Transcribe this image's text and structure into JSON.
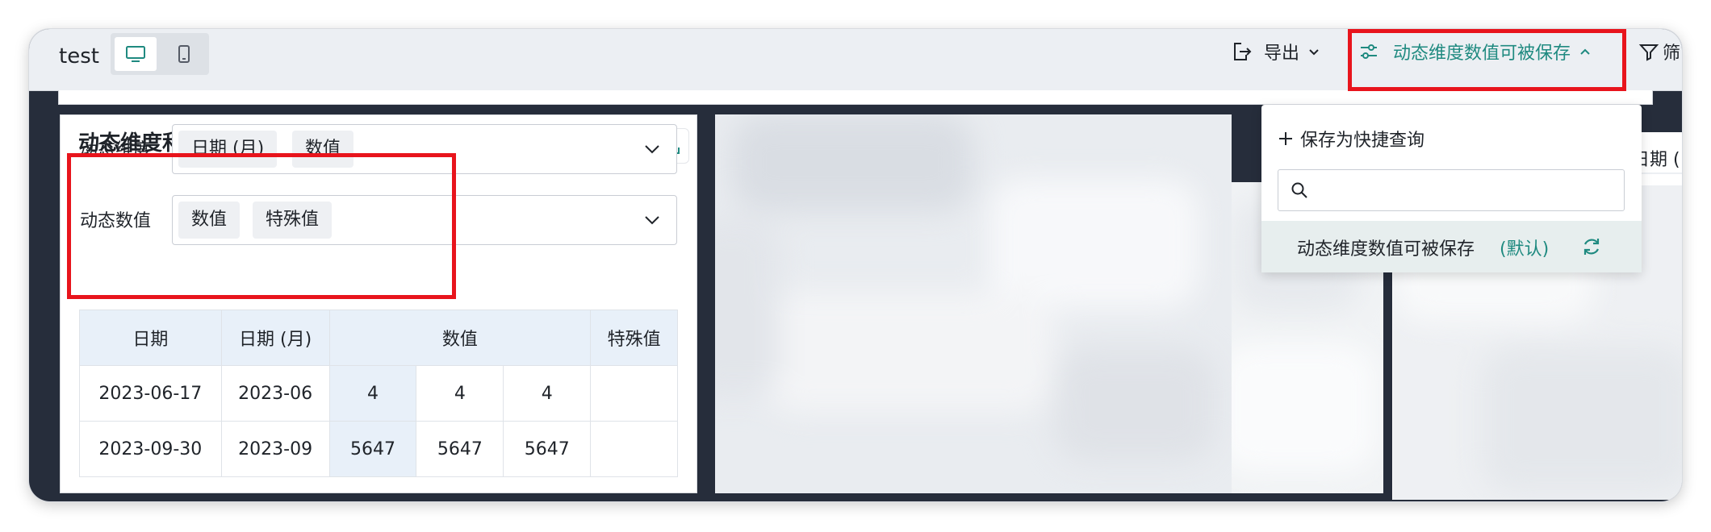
{
  "header": {
    "title": "test",
    "export_label": "导出",
    "query_label": "动态维度数值可被保存",
    "filter_label_partial": "筛"
  },
  "widget": {
    "title": "动态维度和数值",
    "dimension_label": "动态维度",
    "dimension_chips": [
      "日期 (月)",
      "数值"
    ],
    "value_label": "动态数值",
    "value_chips": [
      "数值",
      "特殊值"
    ]
  },
  "table": {
    "headers": [
      "日期",
      "日期 (月)",
      "数值",
      "特殊值"
    ],
    "rows": [
      [
        "2023-06-17",
        "2023-06",
        "4",
        "4",
        "4",
        ""
      ],
      [
        "2023-09-30",
        "2023-09",
        "5647",
        "5647",
        "5647",
        ""
      ]
    ]
  },
  "dropdown": {
    "save_as_label": "保存为快捷查询",
    "search_placeholder": "",
    "item_label": "动态维度数值可被保存",
    "item_default": "(默认)"
  },
  "right_panel": {
    "column_header_partial": "日期 ("
  },
  "colors": {
    "accent": "#1f8a80",
    "highlight_red": "#e8141c",
    "header_fill": "#e8f0f9",
    "dark_background": "#262d3b"
  },
  "icons": [
    "monitor-icon",
    "mobile-icon",
    "export-icon",
    "chevron-down-icon",
    "sliders-icon",
    "chevron-up-icon",
    "filter-icon",
    "download-icon",
    "plus-icon",
    "search-icon",
    "refresh-icon"
  ]
}
